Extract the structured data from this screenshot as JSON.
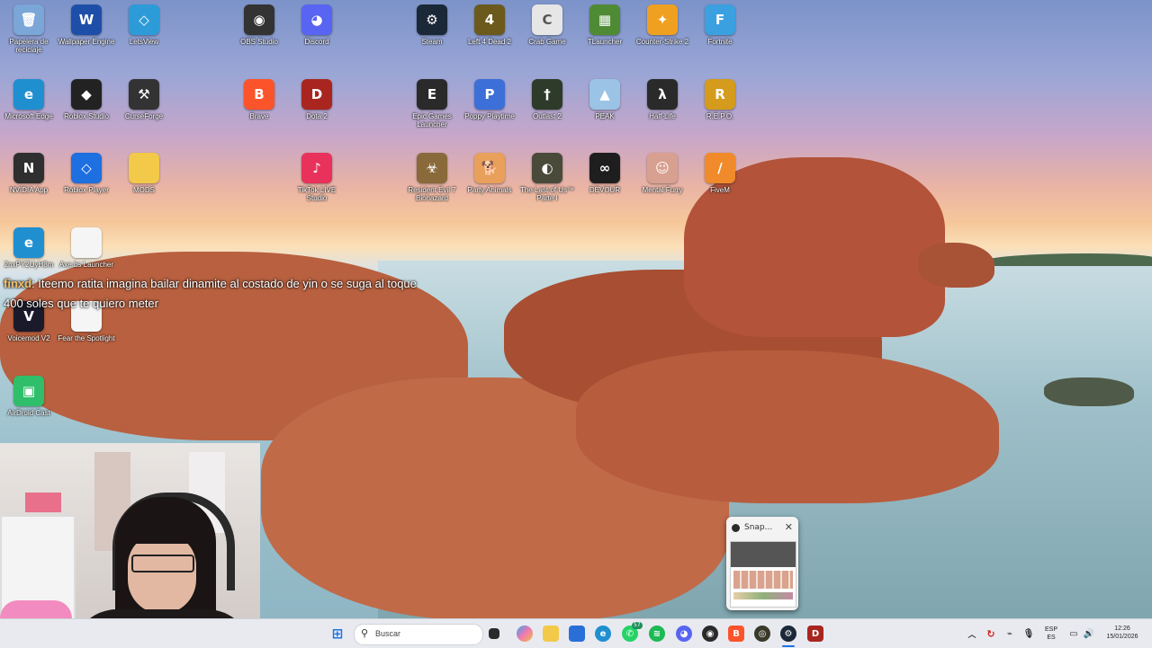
{
  "desktop_icons": [
    {
      "label": "Papelera de reciclaje",
      "icon": "recycle-bin-icon",
      "color": "#7aa6d8",
      "glyph": "🗑"
    },
    {
      "label": "Wallpaper Engine",
      "icon": "wallpaper-engine-icon",
      "color": "#1e4fa8",
      "glyph": "W"
    },
    {
      "label": "LetsView",
      "icon": "letsview-icon",
      "color": "#2d9bd8",
      "glyph": "◇"
    },
    {
      "label": "OBS Studio",
      "icon": "obs-icon",
      "color": "#333333",
      "glyph": "◉"
    },
    {
      "label": "Discord",
      "icon": "discord-icon",
      "color": "#5865f2",
      "glyph": "◕"
    },
    {
      "label": "Steam",
      "icon": "steam-icon",
      "color": "#1b2838",
      "glyph": "⚙"
    },
    {
      "label": "Left 4 Dead 2",
      "icon": "l4d2-icon",
      "color": "#6b5a1c",
      "glyph": "4"
    },
    {
      "label": "Crab Game",
      "icon": "crab-game-icon",
      "color": "#e6e6e6",
      "glyph": "C"
    },
    {
      "label": "TLauncher",
      "icon": "tlauncher-icon",
      "color": "#4f8a35",
      "glyph": "▦"
    },
    {
      "label": "Counter-Strike 2",
      "icon": "cs2-icon",
      "color": "#f0a020",
      "glyph": "✦"
    },
    {
      "label": "Fortnite",
      "icon": "fortnite-icon",
      "color": "#3aa0e0",
      "glyph": "F"
    },
    {
      "label": "Microsoft Edge",
      "icon": "edge-icon",
      "color": "#1f8fd0",
      "glyph": "e"
    },
    {
      "label": "Roblox Studio",
      "icon": "roblox-studio-icon",
      "color": "#222222",
      "glyph": "◆"
    },
    {
      "label": "CurseForge",
      "icon": "curseforge-icon",
      "color": "#333333",
      "glyph": "⚒"
    },
    {
      "label": "Brave",
      "icon": "brave-icon",
      "color": "#fb542b",
      "glyph": "B"
    },
    {
      "label": "Dota 2",
      "icon": "dota2-icon",
      "color": "#a8261f",
      "glyph": "D"
    },
    {
      "label": "Epic Games Launcher",
      "icon": "epic-games-icon",
      "color": "#2a2a2a",
      "glyph": "E"
    },
    {
      "label": "Poppy Playtime",
      "icon": "poppy-playtime-icon",
      "color": "#3d6fd8",
      "glyph": "P"
    },
    {
      "label": "Outlast 2",
      "icon": "outlast2-icon",
      "color": "#2e3a2a",
      "glyph": "†"
    },
    {
      "label": "PEAK",
      "icon": "peak-icon",
      "color": "#9ac3e6",
      "glyph": "▲"
    },
    {
      "label": "Half-Life",
      "icon": "half-life-icon",
      "color": "#2a2a2a",
      "glyph": "λ"
    },
    {
      "label": "R.E.P.O.",
      "icon": "repo-icon",
      "color": "#d49b1c",
      "glyph": "R"
    },
    {
      "label": "NVIDIA App",
      "icon": "nvidia-icon",
      "color": "#2f2f2f",
      "glyph": "N"
    },
    {
      "label": "Roblox Player",
      "icon": "roblox-player-icon",
      "color": "#1e6fe0",
      "glyph": "◇"
    },
    {
      "label": "MODS",
      "icon": "folder-icon",
      "color": "#f3c94a",
      "glyph": ""
    },
    {
      "label": "TikTok LIVE Studio",
      "icon": "tiktok-live-icon",
      "color": "#e8315b",
      "glyph": "♪"
    },
    {
      "label": "Resident Evil 7 Biohazard",
      "icon": "re7-icon",
      "color": "#8a6a3a",
      "glyph": "☣"
    },
    {
      "label": "Party Animals",
      "icon": "party-animals-icon",
      "color": "#e8a05a",
      "glyph": "🐕"
    },
    {
      "label": "The Last of Us™ Parte I",
      "icon": "tlou-icon",
      "color": "#4a4a3a",
      "glyph": "◐"
    },
    {
      "label": "DEVOUR",
      "icon": "devour-icon",
      "color": "#1e1e1e",
      "glyph": "∞"
    },
    {
      "label": "Mental Furry",
      "icon": "mental-furry-icon",
      "color": "#d8a090",
      "glyph": "☺"
    },
    {
      "label": "FiveM",
      "icon": "fivem-icon",
      "color": "#f08a2a",
      "glyph": "/"
    },
    {
      "label": "2nxPY2UyH8m",
      "icon": "edge-icon-2",
      "color": "#1f8fd0",
      "glyph": "e"
    },
    {
      "label": "Axe.bs Launcher",
      "icon": "file-icon",
      "color": "#f5f5f5",
      "glyph": ""
    },
    {
      "label": "Voicemod V2",
      "icon": "voicemod-icon",
      "color": "#1a1a2a",
      "glyph": "V"
    },
    {
      "label": "Fear the Spotlight",
      "icon": "file-icon-2",
      "color": "#f5f5f5",
      "glyph": ""
    },
    {
      "label": "AirDroid Cast",
      "icon": "airdroid-icon",
      "color": "#2fbf6a",
      "glyph": "▣"
    }
  ],
  "chat": {
    "user": "finxd",
    "sep": ": ",
    "message_line1": "Iteemo ratita imagina bailar dinamite al costado de yin o se suga al toque",
    "message_line2": "400 soles que te quiero meter"
  },
  "snap_popup": {
    "title": "Snap..."
  },
  "taskbar": {
    "search_placeholder": "Buscar",
    "badge_count": "57",
    "lang_top": "ESP",
    "lang_bottom": "ES",
    "time": "12:26",
    "date": "15/01/2026"
  }
}
